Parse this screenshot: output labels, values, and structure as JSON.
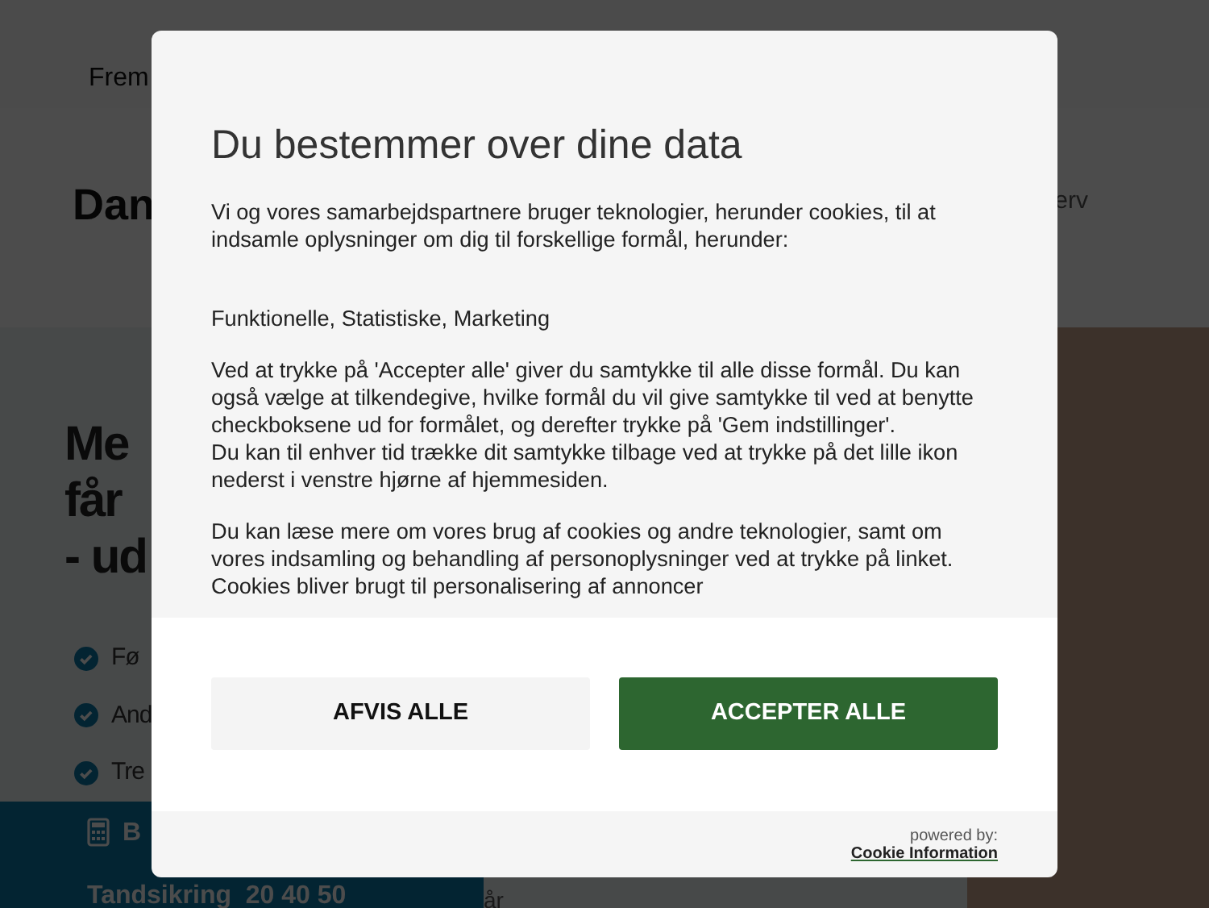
{
  "background_page": {
    "top_bar": {
      "nav_text": "Frem"
    },
    "header": {
      "logo_text": "Dan",
      "nav_text": "erv"
    },
    "hero": {
      "heading_lines": [
        "Me",
        "får",
        "- ud"
      ],
      "checklist": [
        "Fø",
        "And",
        "Tre"
      ],
      "call_bar": {
        "title": "B",
        "phone": "Tandsikring  20 40 50"
      },
      "side_text": "år"
    }
  },
  "consent_dialog": {
    "title": "Du bestemmer over dine data",
    "paragraphs": [
      [
        "Vi og vores samarbejdspartnere bruger teknologier, herunder cookies, til at indsamle oplysninger om dig til forskellige formål, herunder:"
      ],
      [
        "Funktionelle, Statistiske, Marketing"
      ],
      [
        "Ved at trykke på 'Accepter alle' giver du samtykke til alle disse formål. Du kan også vælge at tilkendegive, hvilke formål du vil give samtykke til ved at benytte checkboksene ud for formålet, og derefter trykke på 'Gem indstillinger'.",
        "Du kan til enhver tid trække dit samtykke tilbage ved at trykke på det lille ikon nederst i venstre hjørne af hjemmesiden."
      ],
      [
        "Du kan læse mere om vores brug af cookies og andre teknologier, samt om vores indsamling og behandling af personoplysninger ved at trykke på linket. Cookies bliver brugt til personalisering af annoncer"
      ]
    ],
    "buttons": [
      {
        "label": "AFVIS ALLE",
        "kind": "secondary"
      },
      {
        "label": "ACCEPTER ALLE",
        "kind": "primary"
      }
    ],
    "footer": {
      "powered_by": "powered by:",
      "link": "Cookie Information"
    }
  }
}
